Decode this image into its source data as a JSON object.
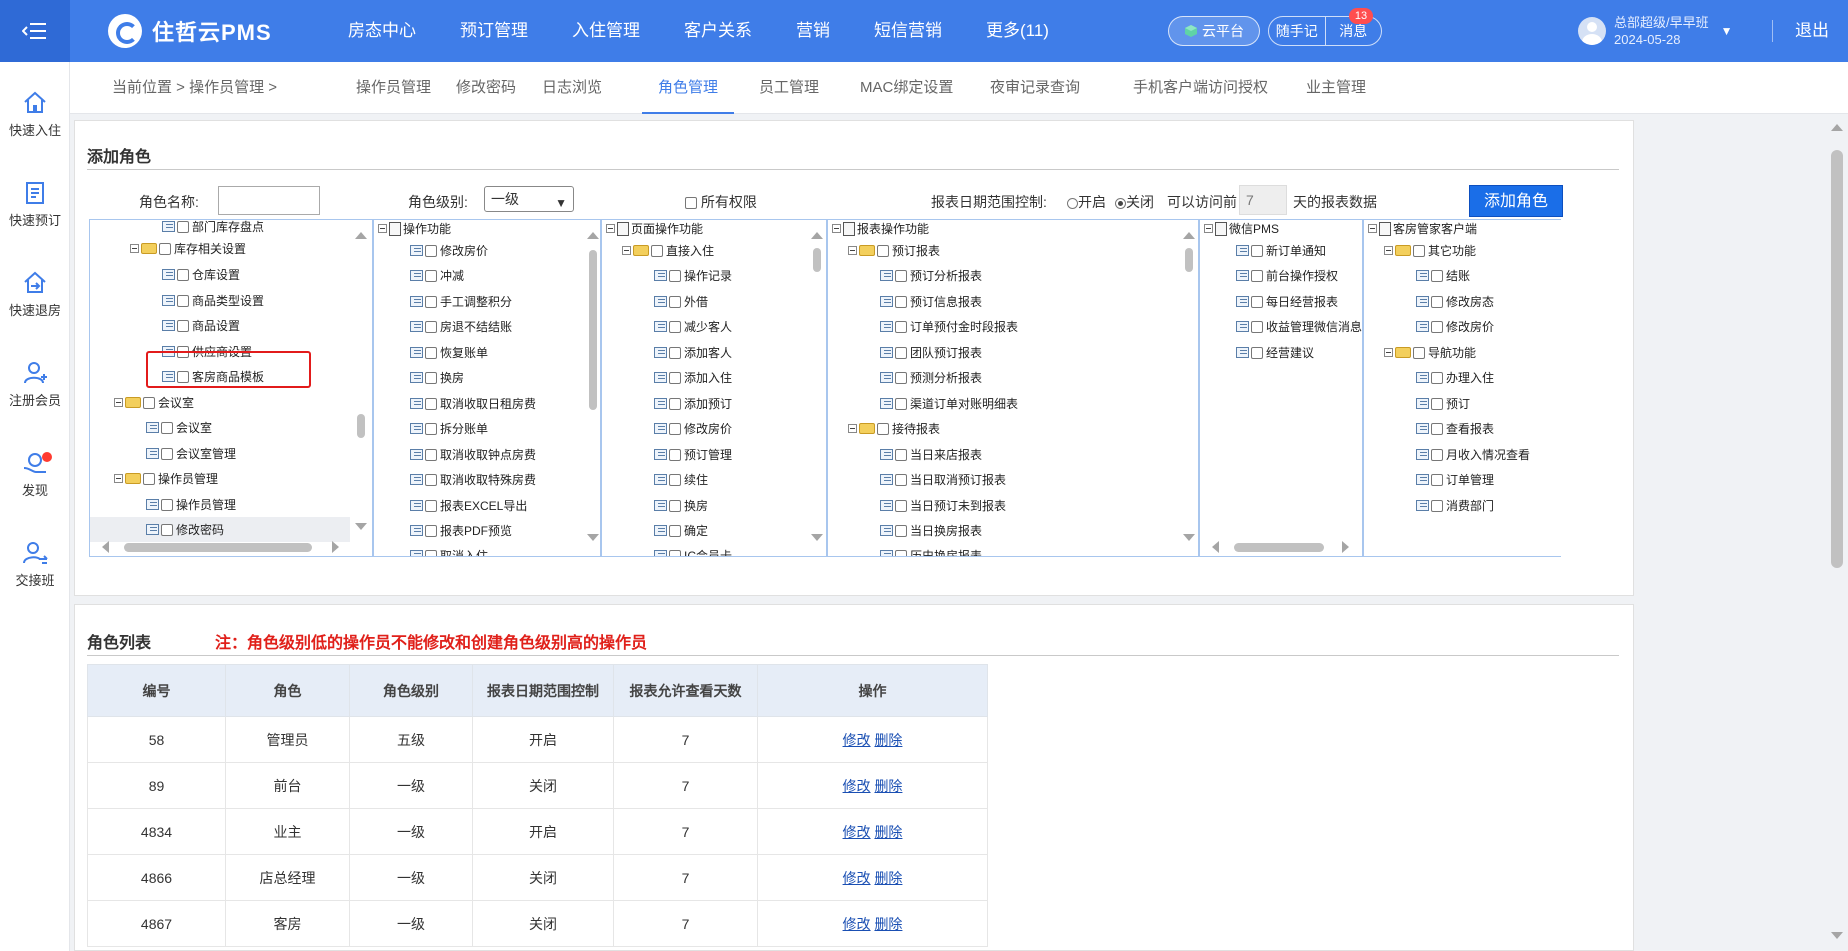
{
  "header": {
    "app_name": "住哲云PMS",
    "nav": [
      "房态中心",
      "预订管理",
      "入住管理",
      "客户关系",
      "营销",
      "短信营销",
      "更多(11)"
    ],
    "cloud_label": "云平台",
    "memo_label": "随手记",
    "msg_label": "消息",
    "msg_count": "13",
    "user_line1": "总部超级/早早班",
    "user_line2": "2024-05-28",
    "logout": "退出"
  },
  "sidebar": {
    "items": [
      {
        "label": "快速入住",
        "icon": "home-icon"
      },
      {
        "label": "快速预订",
        "icon": "booking-icon"
      },
      {
        "label": "快速退房",
        "icon": "checkout-icon"
      },
      {
        "label": "注册会员",
        "icon": "add-member-icon"
      },
      {
        "label": "发现",
        "icon": "discover-icon"
      },
      {
        "label": "交接班",
        "icon": "shift-handover-icon"
      }
    ]
  },
  "breadcrumb": "当前位置 > 操作员管理 >",
  "tabs": [
    "操作员管理",
    "修改密码",
    "日志浏览",
    "角色管理",
    "员工管理",
    "MAC绑定设置",
    "夜审记录查询",
    "手机客户端访问授权",
    "业主管理"
  ],
  "active_tab": "角色管理",
  "add_role": {
    "title": "添加角色",
    "name_label": "角色名称:",
    "name_value": "",
    "level_label": "角色级别:",
    "level_value": "一级",
    "all_perm_label": "所有权限",
    "date_ctrl_label": "报表日期范围控制:",
    "radio_on_label": "开启",
    "radio_off_label": "关闭",
    "access_prefix": "可以访问前",
    "days_value": "7",
    "access_suffix": "天的报表数据",
    "add_button": "添加角色"
  },
  "trees": {
    "col1": [
      "部门库存盘点",
      "库存相关设置",
      "仓库设置",
      "商品类型设置",
      "商品设置",
      "供应商设置",
      "客房商品模板",
      "会议室",
      "会议室",
      "会议室管理",
      "操作员管理",
      "操作员管理",
      "修改密码"
    ],
    "col2": [
      "操作功能",
      "修改房价",
      "冲减",
      "手工调整积分",
      "房退不结结账",
      "恢复账单",
      "换房",
      "取消收取日租房费",
      "拆分账单",
      "取消收取钟点房费",
      "取消收取特殊房费",
      "报表EXCEL导出",
      "报表PDF预览",
      "取消入住"
    ],
    "col3": [
      "页面操作功能",
      "直接入住",
      "操作记录",
      "外借",
      "减少客人",
      "添加客人",
      "添加入住",
      "添加预订",
      "修改房价",
      "预订管理",
      "续住",
      "换房",
      "确定",
      "IC会员卡"
    ],
    "col4": [
      "报表操作功能",
      "预订报表",
      "预订分析报表",
      "预订信息报表",
      "订单预付金时段报表",
      "团队预订报表",
      "预测分析报表",
      "渠道订单对账明细表",
      "接待报表",
      "当日来店报表",
      "当日取消预订报表",
      "当日预订未到报表",
      "当日换房报表",
      "历史换房报表"
    ],
    "col5": [
      "微信PMS",
      "新订单通知",
      "前台操作授权",
      "每日经营报表",
      "收益管理微信消息",
      "经营建议"
    ],
    "col6": [
      "客房管家客户端",
      "其它功能",
      "结账",
      "修改房态",
      "修改房价",
      "导航功能",
      "办理入住",
      "预订",
      "查看报表",
      "月收入情况查看",
      "订单管理",
      "消费部门"
    ]
  },
  "role_list": {
    "title": "角色列表",
    "note": "注：角色级别低的操作员不能修改和创建角色级别高的操作员",
    "columns": [
      "编号",
      "角色",
      "角色级别",
      "报表日期范围控制",
      "报表允许查看天数",
      "操作"
    ],
    "rows": [
      [
        "58",
        "管理员",
        "五级",
        "开启",
        "7"
      ],
      [
        "89",
        "前台",
        "一级",
        "关闭",
        "7"
      ],
      [
        "4834",
        "业主",
        "一级",
        "开启",
        "7"
      ],
      [
        "4866",
        "店总经理",
        "一级",
        "关闭",
        "7"
      ],
      [
        "4867",
        "客房",
        "一级",
        "关闭",
        "7"
      ]
    ],
    "edit_label": "修改",
    "delete_label": "删除"
  },
  "colors": {
    "primary": "#3f7de8",
    "button": "#1a6ee8",
    "note": "#e0201a",
    "highlight": "#e21b1b"
  }
}
